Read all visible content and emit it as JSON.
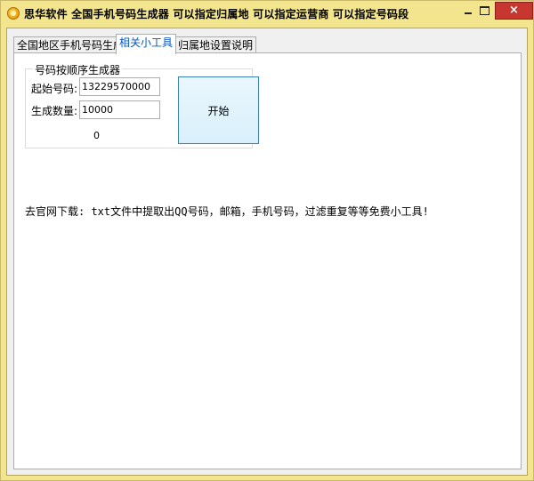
{
  "window": {
    "title": "思华软件  全国手机号码生成器  可以指定归属地  可以指定运营商  可以指定号码段",
    "close_glyph": "×"
  },
  "tabs": [
    {
      "label": "全国地区手机号码生成",
      "active": false
    },
    {
      "label": "相关小工具",
      "active": true
    },
    {
      "label": "归属地设置说明",
      "active": false
    }
  ],
  "generator": {
    "group_title": "号码按顺序生成器",
    "start_label": "起始号码:",
    "start_value": "13229570000",
    "count_label": "生成数量:",
    "count_value": "10000",
    "start_button": "开始",
    "counter": "0"
  },
  "notice": "去官网下载: txt文件中提取出QQ号码，邮箱，手机号码，过滤重复等等免费小工具!",
  "colors": {
    "title_bar": "#f2e58e",
    "close_button": "#c7372f",
    "active_tab_text": "#0a57b8",
    "start_button_border": "#3c7fb1"
  }
}
